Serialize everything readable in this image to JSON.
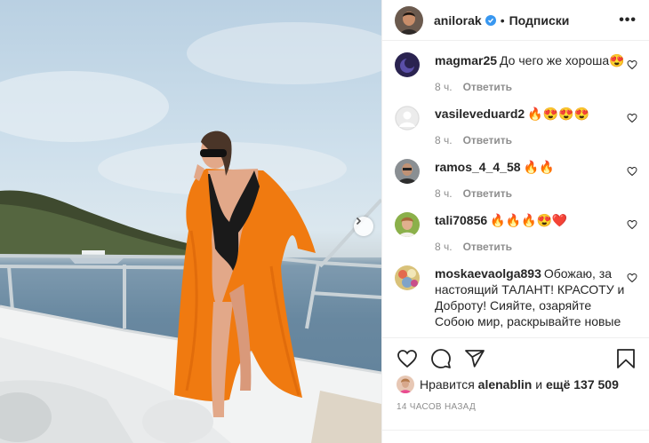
{
  "post": {
    "username": "anilorak",
    "separator": "•",
    "follow_label": "Подписки",
    "more_label": "•••"
  },
  "comments": [
    {
      "user": "magmar25",
      "text": "До чего же хороша😍",
      "time": "8 ч.",
      "reply": "Ответить"
    },
    {
      "user": "vasileveduard2",
      "text": "🔥😍😍😍",
      "time": "8 ч.",
      "reply": "Ответить"
    },
    {
      "user": "ramos_4_4_58",
      "text": "🔥🔥",
      "time": "8 ч.",
      "reply": "Ответить"
    },
    {
      "user": "tali70856",
      "text": "🔥🔥🔥😍❤️",
      "time": "8 ч.",
      "reply": "Ответить"
    },
    {
      "user": "moskaevaolga893",
      "text": "Обожаю, за настоящий ТАЛАНТ! КРАСОТУ и Доброту! Сияйте, озаряйте Собою мир, раскрывайте новые"
    }
  ],
  "likes": {
    "prefix": "Нравится",
    "user": "alenablin",
    "connector": "и",
    "more": "ещё 137 509"
  },
  "time_ago": "14 часов назад",
  "colors": {
    "verified": "#3897f0",
    "swimsuit": "#1a1a1a",
    "robe": "#f07a10"
  }
}
